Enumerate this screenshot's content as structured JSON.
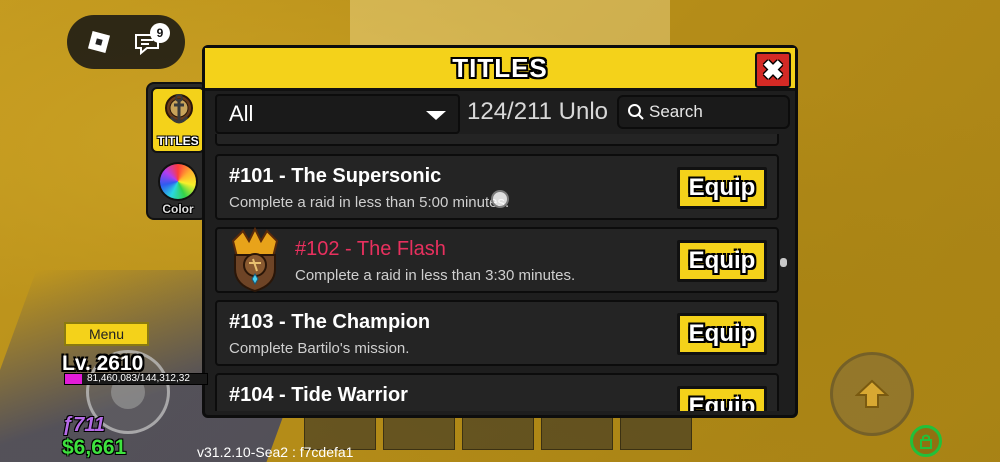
{
  "topbar": {
    "chat_badge_count": "9"
  },
  "side_tabs": {
    "items": [
      {
        "label": "TITLES",
        "icon": "anchor-emblem-icon",
        "active": true
      },
      {
        "label": "Color",
        "icon": "color-wheel-icon",
        "active": false
      }
    ]
  },
  "panel": {
    "title": "TITLES",
    "close_label": "✖",
    "filter": {
      "selected": "All"
    },
    "unlock_count": "124/211 Unlo",
    "search": {
      "placeholder": "Search"
    },
    "titles": [
      {
        "name": "#101 - The Supersonic",
        "description": "Complete a raid in less than 5:00 minutes.",
        "button": "Equip",
        "special": false
      },
      {
        "name": "#102 - The Flash",
        "description": "Complete a raid in less than 3:30 minutes.",
        "button": "Equip",
        "special": true,
        "name_color": "#e8305e"
      },
      {
        "name": "#103 - The Champion",
        "description": "Complete Bartilo's mission.",
        "button": "Equip",
        "special": false
      },
      {
        "name": "#104 - Tide Warrior",
        "description": "",
        "button": "Equip",
        "special": false
      }
    ]
  },
  "hud": {
    "menu_label": "Menu",
    "level": "Lv. 2610",
    "xp_text": "81,460,083/144,312,32",
    "xp_progress": 0.12,
    "fragments": "ƒ711",
    "money": "$6,661",
    "version": "v31.2.10-Sea2 : f7cdefa1"
  },
  "colors": {
    "accent_yellow": "#f4d21a",
    "close_red": "#d42a25",
    "panel_bg": "#1e1e1e",
    "flash_title": "#e8305e",
    "money_green": "#3ee23e",
    "fragments_purple": "#b66be8",
    "xp_magenta": "#e21cd8"
  }
}
